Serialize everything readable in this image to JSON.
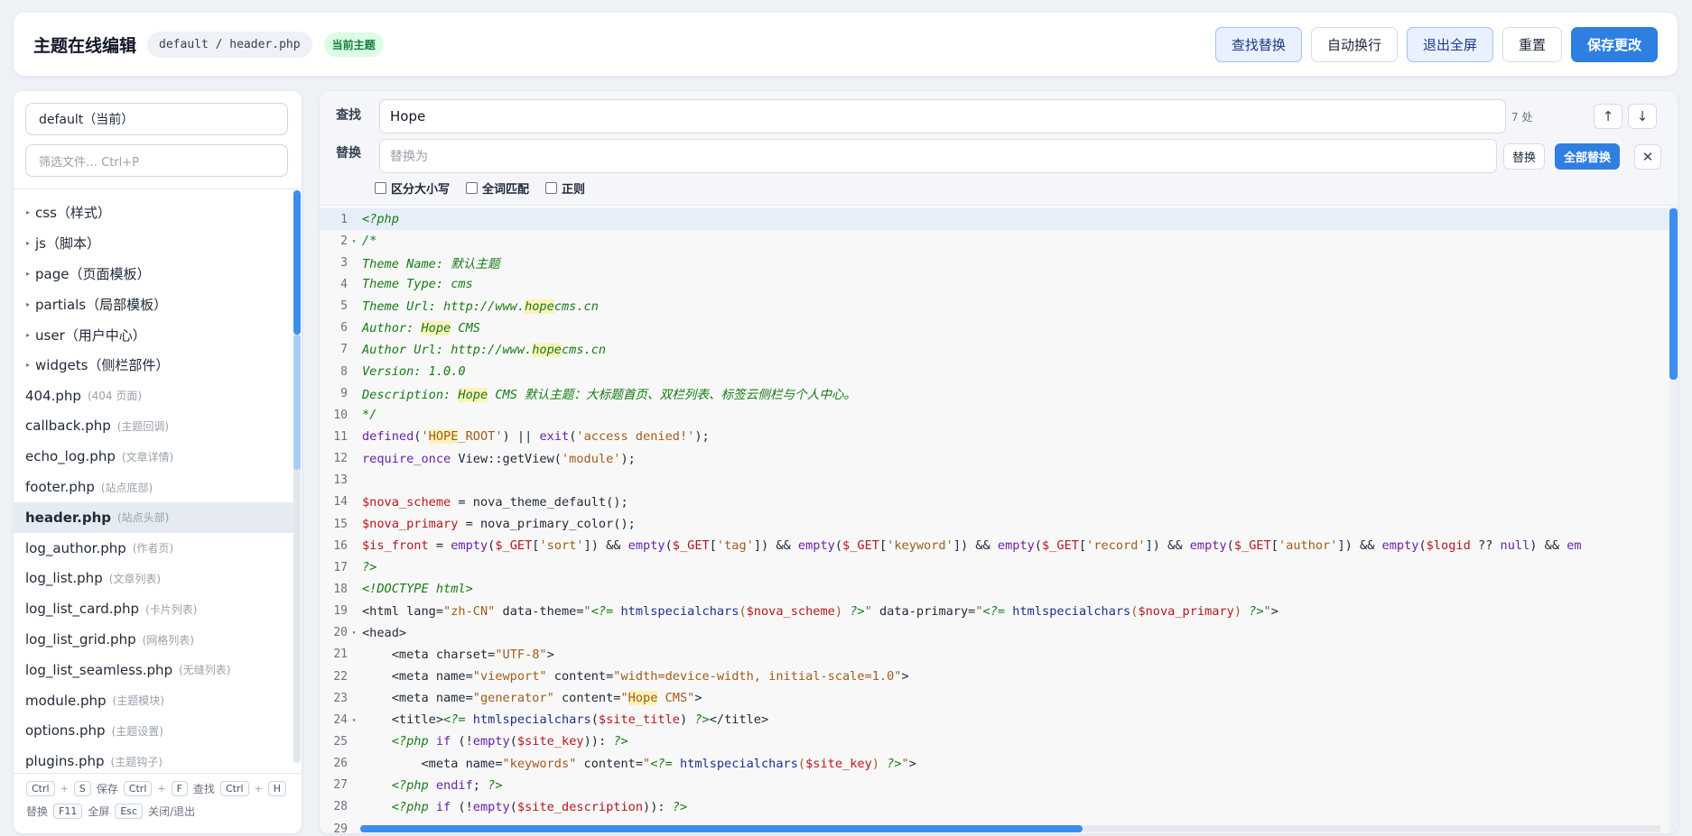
{
  "header": {
    "title": "主题在线编辑",
    "path": "default / header.php",
    "badge": "当前主题",
    "buttons": {
      "find_replace": "查找替换",
      "word_wrap": "自动换行",
      "exit_fullscreen": "退出全屏",
      "reset": "重置",
      "save": "保存更改"
    }
  },
  "sidebar": {
    "theme_select": "default（当前）",
    "filter_placeholder": "筛选文件… Ctrl+P",
    "folders": [
      {
        "name": "css（样式）"
      },
      {
        "name": "js（脚本）"
      },
      {
        "name": "page（页面模板）"
      },
      {
        "name": "partials（局部模板）"
      },
      {
        "name": "user（用户中心）"
      },
      {
        "name": "widgets（侧栏部件）"
      }
    ],
    "files": [
      {
        "name": "404.php",
        "hint": "(404 页面)"
      },
      {
        "name": "callback.php",
        "hint": "(主题回调)"
      },
      {
        "name": "echo_log.php",
        "hint": "(文章详情)"
      },
      {
        "name": "footer.php",
        "hint": "(站点底部)"
      },
      {
        "name": "header.php",
        "hint": "(站点头部)"
      },
      {
        "name": "log_author.php",
        "hint": "(作者页)"
      },
      {
        "name": "log_list.php",
        "hint": "(文章列表)"
      },
      {
        "name": "log_list_card.php",
        "hint": "(卡片列表)"
      },
      {
        "name": "log_list_grid.php",
        "hint": "(网格列表)"
      },
      {
        "name": "log_list_seamless.php",
        "hint": "(无缝列表)"
      },
      {
        "name": "module.php",
        "hint": "(主题模块)"
      },
      {
        "name": "options.php",
        "hint": "(主题设置)"
      },
      {
        "name": "plugins.php",
        "hint": "(主题钩子)"
      }
    ],
    "selected_file": "header.php",
    "shortcuts": {
      "ctrl": "Ctrl",
      "s": "S",
      "save": "保存",
      "f": "F",
      "find": "查找",
      "h": "H",
      "replace": "替换",
      "f11": "F11",
      "fullscreen": "全屏",
      "esc": "Esc",
      "close": "关闭/退出",
      "plus": "+"
    }
  },
  "findbar": {
    "find_label": "查找",
    "find_value": "Hope",
    "match_count": "7 处",
    "replace_label": "替换",
    "replace_placeholder": "替换为",
    "replace_btn": "替换",
    "replace_all_btn": "全部替换",
    "prev_icon": "↑",
    "next_icon": "↓",
    "close_icon": "✕",
    "options": {
      "case": "区分大小写",
      "word": "全词匹配",
      "regex": "正则"
    }
  },
  "editor": {
    "active_line": 1,
    "lines": [
      {
        "n": "1",
        "fold": "",
        "html": "<span class='cm'>&lt;?php</span>"
      },
      {
        "n": "2",
        "fold": "▾",
        "html": "<span class='cm'>/*</span>"
      },
      {
        "n": "3",
        "fold": "",
        "html": "<span class='cm'>Theme Name: 默认主题</span>"
      },
      {
        "n": "4",
        "fold": "",
        "html": "<span class='cm'>Theme Type: cms</span>"
      },
      {
        "n": "5",
        "fold": "",
        "html": "<span class='cm'>Theme Url: http://www.<span class='hl'>hope</span>cms.cn</span>"
      },
      {
        "n": "6",
        "fold": "",
        "html": "<span class='cm'>Author: <span class='hl'>Hope</span> CMS</span>"
      },
      {
        "n": "7",
        "fold": "",
        "html": "<span class='cm'>Author Url: http://www.<span class='hl'>hope</span>cms.cn</span>"
      },
      {
        "n": "8",
        "fold": "",
        "html": "<span class='cm'>Version: 1.0.0</span>"
      },
      {
        "n": "9",
        "fold": "",
        "html": "<span class='cm'>Description: <span class='hl'>Hope</span> CMS 默认主题：大标题首页、双栏列表、标签云侧栏与个人中心。</span>"
      },
      {
        "n": "10",
        "fold": "",
        "html": "<span class='cm'>*/</span>"
      },
      {
        "n": "11",
        "fold": "",
        "html": "<span class='kw'>defined</span>(<span class='str'>'<span class='hl'>HOPE</span>_ROOT'</span>) || <span class='kw'>exit</span>(<span class='str'>'access denied!'</span>);"
      },
      {
        "n": "12",
        "fold": "",
        "html": "<span class='kw'>require_once</span> View::getView(<span class='str'>'module'</span>);"
      },
      {
        "n": "13",
        "fold": "",
        "html": ""
      },
      {
        "n": "14",
        "fold": "",
        "html": "<span class='var'>$nova_scheme</span> = nova_theme_default();"
      },
      {
        "n": "15",
        "fold": "",
        "html": "<span class='var'>$nova_primary</span> = nova_primary_color();"
      },
      {
        "n": "16",
        "fold": "",
        "html": "<span class='var'>$is_front</span> = <span class='kw'>empty</span>(<span class='var'>$_GET</span>[<span class='str'>'sort'</span>]) &amp;&amp; <span class='kw'>empty</span>(<span class='var'>$_GET</span>[<span class='str'>'tag'</span>]) &amp;&amp; <span class='kw'>empty</span>(<span class='var'>$_GET</span>[<span class='str'>'keyword'</span>]) &amp;&amp; <span class='kw'>empty</span>(<span class='var'>$_GET</span>[<span class='str'>'record'</span>]) &amp;&amp; <span class='kw'>empty</span>(<span class='var'>$_GET</span>[<span class='str'>'author'</span>]) &amp;&amp; <span class='kw'>empty</span>(<span class='var'>$logid</span> ?? <span class='kw'>null</span>) &amp;&amp; <span class='kw'>em</span>"
      },
      {
        "n": "17",
        "fold": "",
        "html": "<span class='cm'>?&gt;</span>"
      },
      {
        "n": "18",
        "fold": "",
        "html": "<span class='cm'>&lt;!DOCTYPE html&gt;</span>"
      },
      {
        "n": "19",
        "fold": "",
        "html": "&lt;html lang=<span class='str'>\"zh-CN\"</span> data-theme=<span class='str'>\"<span class='cm'>&lt;?=</span> <span class='fn'>htmlspecialchars</span>(<span class='var'>$nova_scheme</span>) <span class='cm'>?&gt;</span>\"</span> data-primary=<span class='str'>\"<span class='cm'>&lt;?=</span> <span class='fn'>htmlspecialchars</span>(<span class='var'>$nova_primary</span>) <span class='cm'>?&gt;</span>\"</span>&gt;"
      },
      {
        "n": "20",
        "fold": "▾",
        "html": "&lt;head&gt;"
      },
      {
        "n": "21",
        "fold": "",
        "html": "    &lt;meta charset=<span class='str'>\"UTF-8\"</span>&gt;"
      },
      {
        "n": "22",
        "fold": "",
        "html": "    &lt;meta name=<span class='str'>\"viewport\"</span> content=<span class='str'>\"width=device-width, initial-scale=1.0\"</span>&gt;"
      },
      {
        "n": "23",
        "fold": "",
        "html": "    &lt;meta name=<span class='str'>\"generator\"</span> content=<span class='str'>\"<span class='hl'>Hope</span> CMS\"</span>&gt;"
      },
      {
        "n": "24",
        "fold": "▾",
        "html": "    &lt;title&gt;<span class='cm'>&lt;?=</span> <span class='fn'>htmlspecialchars</span>(<span class='var'>$site_title</span>) <span class='cm'>?&gt;</span>&lt;/title&gt;"
      },
      {
        "n": "25",
        "fold": "",
        "html": "    <span class='cm'>&lt;?php</span> <span class='kw'>if</span> (!<span class='kw'>empty</span>(<span class='var'>$site_key</span>)): <span class='cm'>?&gt;</span>"
      },
      {
        "n": "26",
        "fold": "",
        "html": "        &lt;meta name=<span class='str'>\"keywords\"</span> content=<span class='str'>\"<span class='cm'>&lt;?=</span> <span class='fn'>htmlspecialchars</span>(<span class='var'>$site_key</span>) <span class='cm'>?&gt;</span>\"</span>&gt;"
      },
      {
        "n": "27",
        "fold": "",
        "html": "    <span class='cm'>&lt;?php</span> <span class='kw'>endif</span>; <span class='cm'>?&gt;</span>"
      },
      {
        "n": "28",
        "fold": "",
        "html": "    <span class='cm'>&lt;?php</span> <span class='kw'>if</span> (!<span class='kw'>empty</span>(<span class='var'>$site_description</span>)): <span class='cm'>?&gt;</span>"
      },
      {
        "n": "29",
        "fold": "",
        "html": ""
      }
    ]
  }
}
